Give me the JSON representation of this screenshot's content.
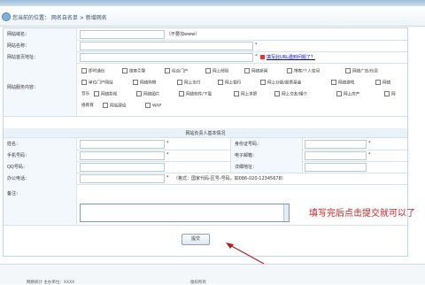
{
  "breadcrumb": {
    "text": "您当前的位置： 网名自名单 > 新增网名"
  },
  "site_section": {
    "rows": [
      {
        "label": "网站域名：",
        "value": "",
        "note": "（不要加www）"
      },
      {
        "label": "网站名称：",
        "value": "",
        "note": "*"
      },
      {
        "label": "网站首页地址：",
        "value": "",
        "note": "*",
        "link": "填写此URL遇到问题了？"
      }
    ],
    "services_label": "网站服务内容：",
    "services_line1": [
      "即时通信",
      "搜索引擎",
      "综合门户",
      "网上邮局",
      "网络新闻",
      "博客/个人空间",
      "网络广告/信息"
    ],
    "services_line2": [
      "单位门户网站",
      "网络购物",
      "网上支付",
      "网上银行",
      "网上炒股/股票基金",
      "网络游戏",
      "网络"
    ],
    "services_line3": [
      "音乐",
      "网络影视",
      "网络图片",
      "网络软件/下载",
      "网上求职",
      "网上交友/婚介",
      "网上房产",
      "网"
    ],
    "services_line4": [
      "络教育",
      "网站建设",
      "WAP"
    ]
  },
  "person_section": {
    "title": "网站负责人基本情况",
    "name_label": "姓名：",
    "id_label": "身份证号码：",
    "mobile_label": "手机号码：",
    "email_label": "电子邮箱：",
    "qq_label": "QQ号码：",
    "address_label": "详细地址：",
    "phone_label": "办公电话：",
    "phone_note": "（格式：国家代码-区号-号码，如086-020-12345678）",
    "remark_label": "备注：",
    "required": "*"
  },
  "submit_label": "提交",
  "annotation": "填写完后点击提交就可以了",
  "footer": {
    "left": "网络统计  主办单位：XXXX",
    "right": "版权所有"
  }
}
